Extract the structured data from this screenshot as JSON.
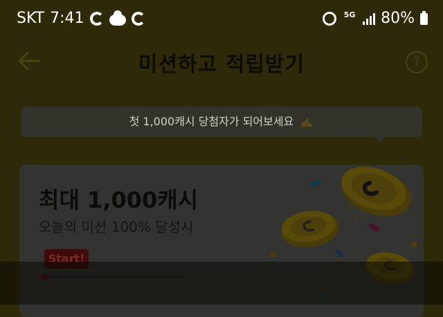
{
  "status_bar": {
    "carrier": "SKT",
    "time": "7:41",
    "network": "5G",
    "battery": "80%"
  },
  "header": {
    "title": "미션하고 적립받기",
    "help_symbol": "?"
  },
  "notice": {
    "text": "첫 1,000캐시 당첨자가 되어보세요"
  },
  "mission_card": {
    "title": "최대 1,000캐시",
    "subtitle": "오늘의 미션 100% 달성시",
    "start_label": "Start!",
    "progress": 0
  },
  "icons": {
    "back": "arrow-left-icon",
    "help": "question-circle-icon",
    "alarm": "alarm-icon",
    "signal": "signal-icon",
    "battery": "battery-icon",
    "weather": "cloud-sun-icon",
    "coin": "cash-coin-icon"
  },
  "colors": {
    "background": "#2e2908",
    "title": "#0c0b04",
    "card": "#333332",
    "start_badge": "#3f0a0a"
  }
}
